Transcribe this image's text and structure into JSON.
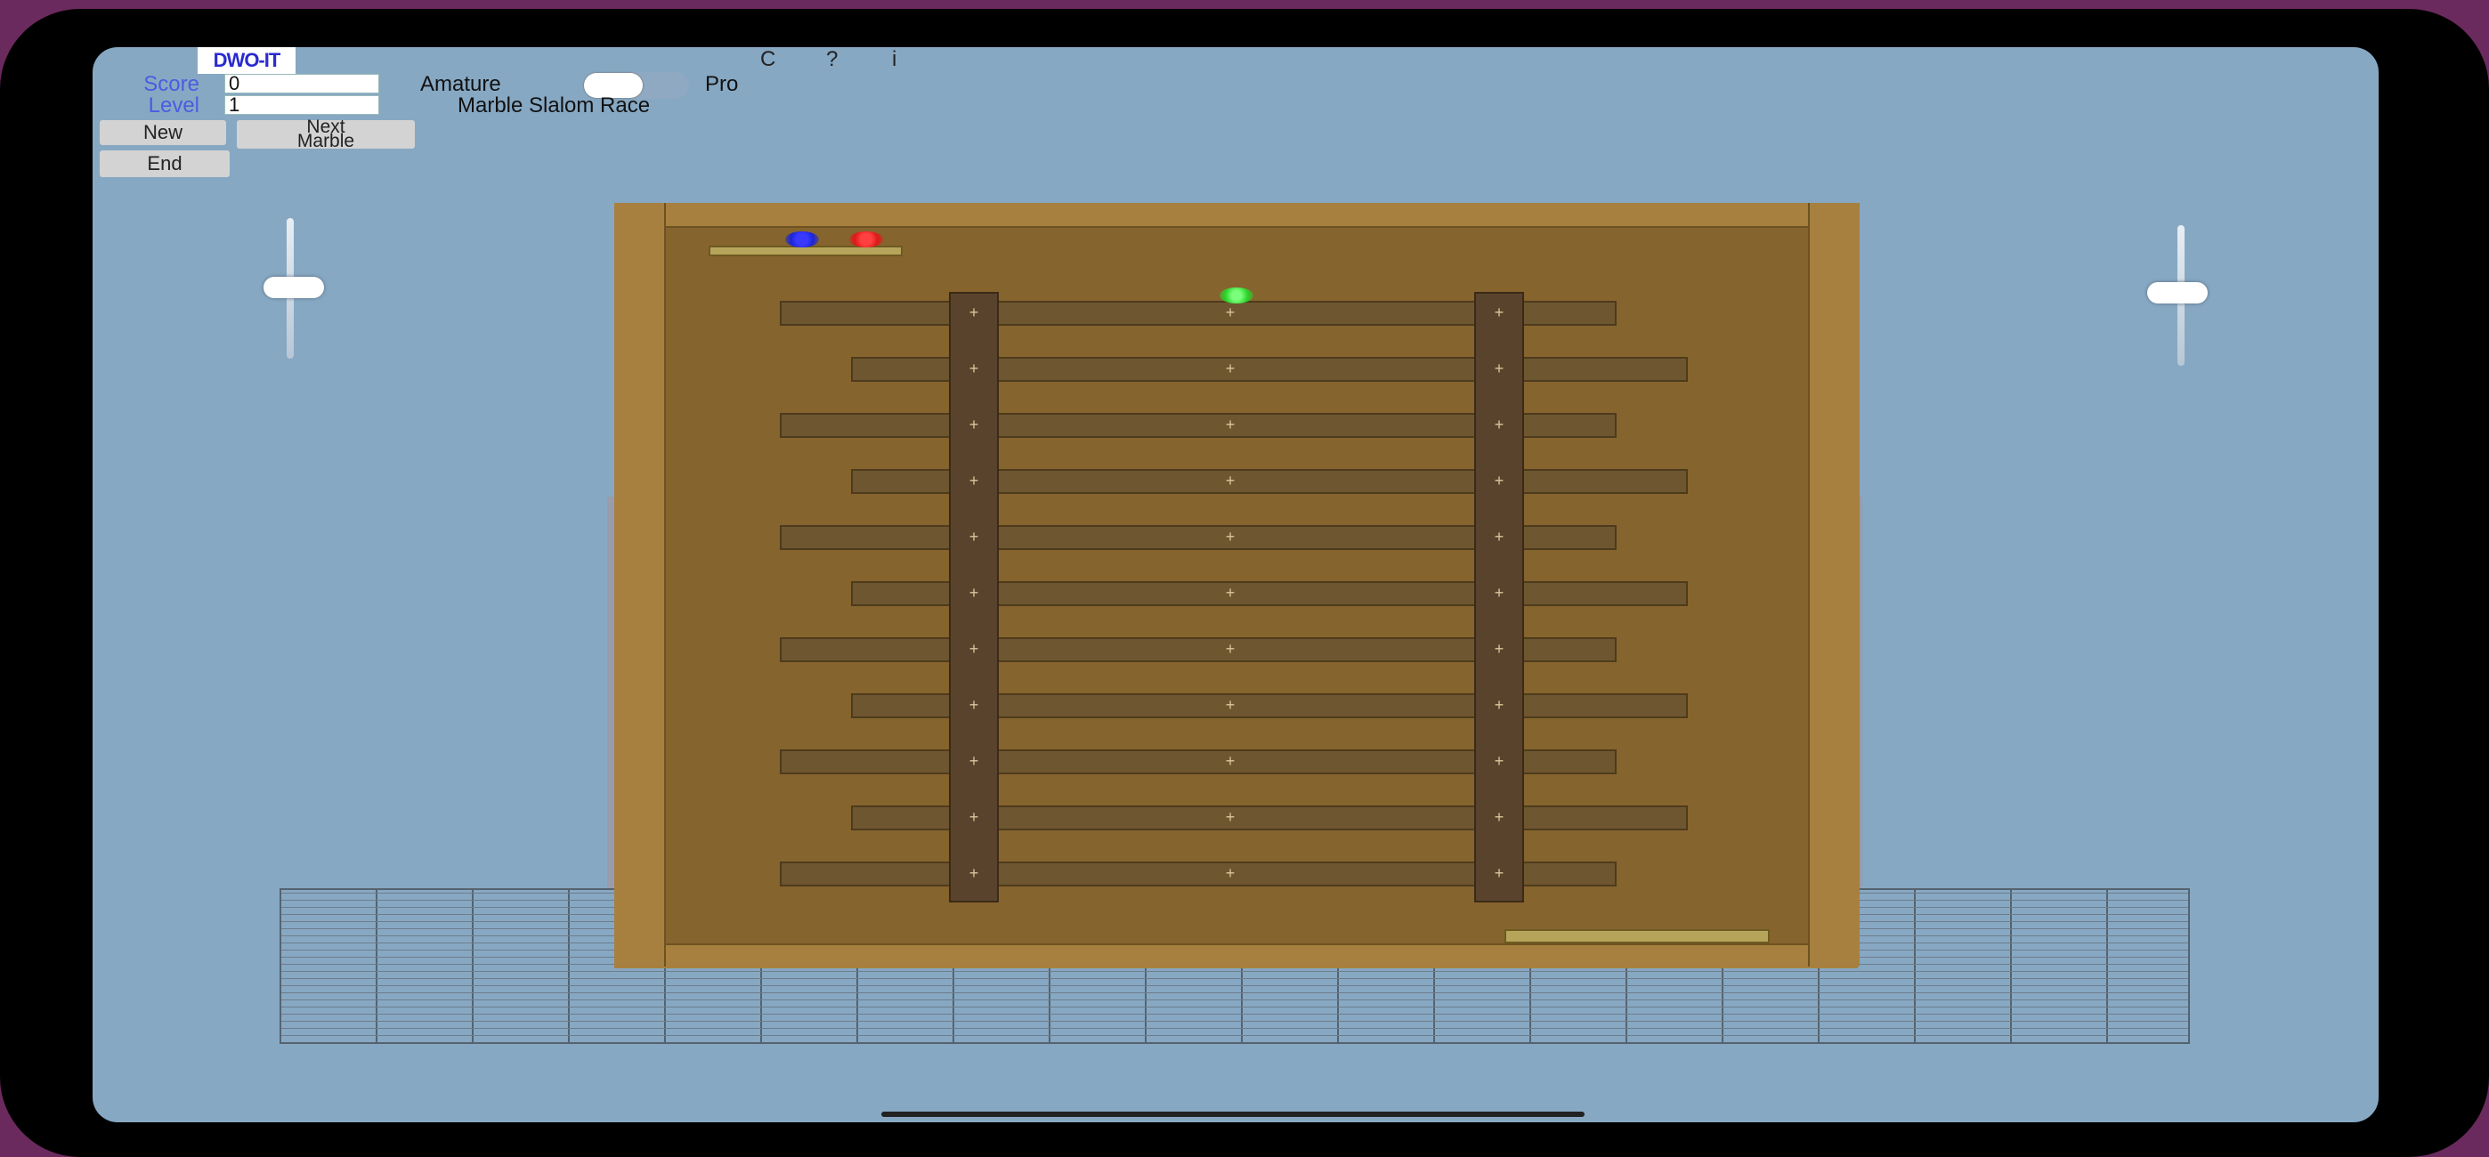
{
  "app": {
    "logo": "DWO-IT"
  },
  "top_icons": [
    {
      "name": "copyright-icon",
      "label": "C"
    },
    {
      "name": "help-icon",
      "label": "?"
    },
    {
      "name": "info-icon",
      "label": "i"
    }
  ],
  "stats": {
    "score_label": "Score",
    "score_value": "0",
    "level_label": "Level",
    "level_value": "1"
  },
  "buttons": {
    "new": "New",
    "next_marble_line1": "Next",
    "next_marble_line2": "Marble",
    "end": "End"
  },
  "mode": {
    "left": "Amature",
    "right": "Pro",
    "selected": "Amature"
  },
  "game_title": "Marble Slalom Race",
  "marbles": [
    {
      "name": "blue-marble",
      "color": "#1a24d8"
    },
    {
      "name": "red-marble",
      "color": "#e01818"
    },
    {
      "name": "green-marble",
      "color": "#2ad42a"
    }
  ],
  "colors": {
    "background": "#87a8c3",
    "board": "#86642e",
    "board_frame": "#a7803f",
    "shelf": "#6e5630",
    "post": "#5a432c"
  }
}
